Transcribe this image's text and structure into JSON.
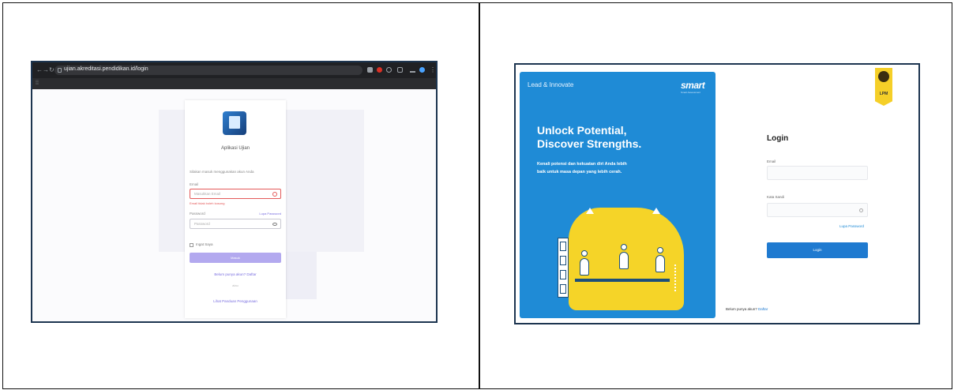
{
  "left": {
    "browser": {
      "url": "ujian.akreditasi.pendidikan.id/login"
    },
    "card": {
      "title": "Aplikasi Ujian",
      "subtitle": "Silakan masuk menggunakan akun Anda",
      "email_label": "Email",
      "email_placeholder": "Masukkan Email",
      "email_error": "Email tidak boleh kosong",
      "password_label": "Password",
      "forgot_label": "Lupa Password",
      "password_placeholder": "Password",
      "remember_label": "Ingat Saya",
      "submit_label": "Masuk",
      "register_link": "Belum punya akun? Daftar",
      "or_label": "atau",
      "guide_link": "Lihat Panduan Penggunaan"
    }
  },
  "right": {
    "brand_left": "Lead & Innovate",
    "brand_right": "smart",
    "brand_right_sub": "Smart Assessment",
    "hero_title_line1": "Unlock Potential,",
    "hero_title_line2": "Discover Strengths.",
    "hero_desc": "Kenali potensi dan kekuatan diri Anda lebih baik untuk masa depan yang lebih cerah.",
    "badge_text": "LPM",
    "login_title": "Login",
    "email_label": "Email",
    "password_label": "Kata Sandi",
    "forgot_label": "Lupa Password",
    "login_button": "Login",
    "signup_text": "Belum punya akun?",
    "signup_link": "Daftar"
  },
  "colors": {
    "panel_blue": "#1f8bd6",
    "button_blue": "#1f7ad0",
    "left_button": "#b3a9ef",
    "error_red": "#e45a5a",
    "illus_yellow": "#f5d428"
  }
}
